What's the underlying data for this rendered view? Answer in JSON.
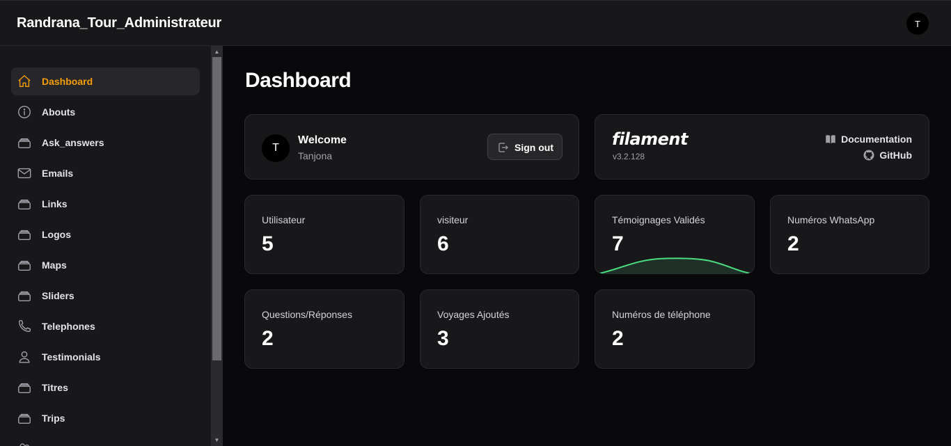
{
  "app": {
    "brand": "Randrana_Tour_Administrateur",
    "user_initial": "T",
    "accent_color": "#f59e0b",
    "spark_color": "#4ade80"
  },
  "sidebar": {
    "items": [
      {
        "label": "Dashboard",
        "icon": "home-icon",
        "active": true
      },
      {
        "label": "Abouts",
        "icon": "info-circle-icon",
        "active": false
      },
      {
        "label": "Ask_answers",
        "icon": "stack-icon",
        "active": false
      },
      {
        "label": "Emails",
        "icon": "envelope-icon",
        "active": false
      },
      {
        "label": "Links",
        "icon": "stack-icon",
        "active": false
      },
      {
        "label": "Logos",
        "icon": "stack-icon",
        "active": false
      },
      {
        "label": "Maps",
        "icon": "stack-icon",
        "active": false
      },
      {
        "label": "Sliders",
        "icon": "stack-icon",
        "active": false
      },
      {
        "label": "Telephones",
        "icon": "phone-icon",
        "active": false
      },
      {
        "label": "Testimonials",
        "icon": "user-icon",
        "active": false
      },
      {
        "label": "Titres",
        "icon": "stack-icon",
        "active": false
      },
      {
        "label": "Trips",
        "icon": "stack-icon",
        "active": false
      }
    ]
  },
  "main": {
    "title": "Dashboard",
    "welcome": {
      "title": "Welcome",
      "name": "Tanjona",
      "avatar_initial": "T",
      "signout_label": "Sign out"
    },
    "filament": {
      "logo": "filament",
      "version": "v3.2.128",
      "documentation_label": "Documentation",
      "github_label": "GitHub"
    },
    "stats": [
      {
        "label": "Utilisateur",
        "value": "5"
      },
      {
        "label": "visiteur",
        "value": "6"
      },
      {
        "label": "Témoignages Validés",
        "value": "7",
        "sparkline": true
      },
      {
        "label": "Numéros WhatsApp",
        "value": "2"
      },
      {
        "label": "Questions/Réponses",
        "value": "2"
      },
      {
        "label": "Voyages Ajoutés",
        "value": "3"
      },
      {
        "label": "Numéros de téléphone",
        "value": "2"
      }
    ]
  }
}
